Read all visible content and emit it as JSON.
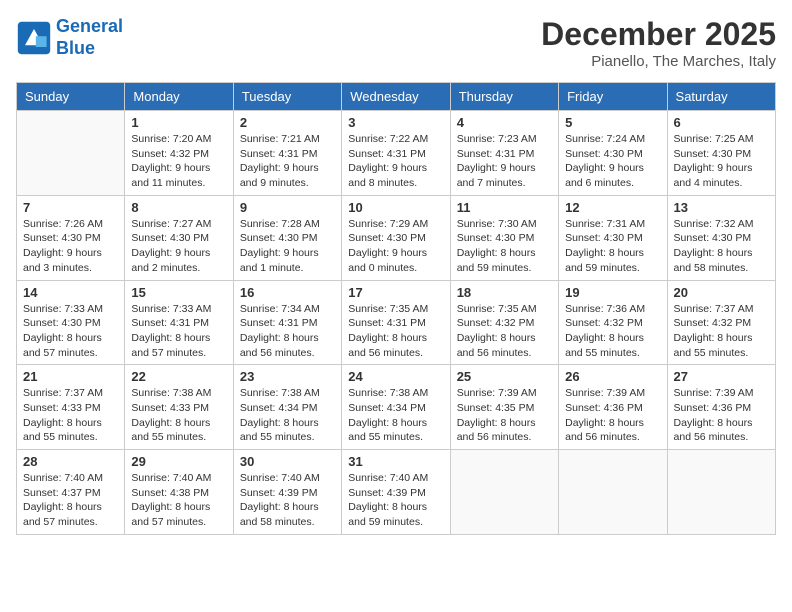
{
  "logo": {
    "line1": "General",
    "line2": "Blue"
  },
  "title": "December 2025",
  "location": "Pianello, The Marches, Italy",
  "headers": [
    "Sunday",
    "Monday",
    "Tuesday",
    "Wednesday",
    "Thursday",
    "Friday",
    "Saturday"
  ],
  "weeks": [
    [
      {
        "day": "",
        "info": ""
      },
      {
        "day": "1",
        "info": "Sunrise: 7:20 AM\nSunset: 4:32 PM\nDaylight: 9 hours\nand 11 minutes."
      },
      {
        "day": "2",
        "info": "Sunrise: 7:21 AM\nSunset: 4:31 PM\nDaylight: 9 hours\nand 9 minutes."
      },
      {
        "day": "3",
        "info": "Sunrise: 7:22 AM\nSunset: 4:31 PM\nDaylight: 9 hours\nand 8 minutes."
      },
      {
        "day": "4",
        "info": "Sunrise: 7:23 AM\nSunset: 4:31 PM\nDaylight: 9 hours\nand 7 minutes."
      },
      {
        "day": "5",
        "info": "Sunrise: 7:24 AM\nSunset: 4:30 PM\nDaylight: 9 hours\nand 6 minutes."
      },
      {
        "day": "6",
        "info": "Sunrise: 7:25 AM\nSunset: 4:30 PM\nDaylight: 9 hours\nand 4 minutes."
      }
    ],
    [
      {
        "day": "7",
        "info": "Sunrise: 7:26 AM\nSunset: 4:30 PM\nDaylight: 9 hours\nand 3 minutes."
      },
      {
        "day": "8",
        "info": "Sunrise: 7:27 AM\nSunset: 4:30 PM\nDaylight: 9 hours\nand 2 minutes."
      },
      {
        "day": "9",
        "info": "Sunrise: 7:28 AM\nSunset: 4:30 PM\nDaylight: 9 hours\nand 1 minute."
      },
      {
        "day": "10",
        "info": "Sunrise: 7:29 AM\nSunset: 4:30 PM\nDaylight: 9 hours\nand 0 minutes."
      },
      {
        "day": "11",
        "info": "Sunrise: 7:30 AM\nSunset: 4:30 PM\nDaylight: 8 hours\nand 59 minutes."
      },
      {
        "day": "12",
        "info": "Sunrise: 7:31 AM\nSunset: 4:30 PM\nDaylight: 8 hours\nand 59 minutes."
      },
      {
        "day": "13",
        "info": "Sunrise: 7:32 AM\nSunset: 4:30 PM\nDaylight: 8 hours\nand 58 minutes."
      }
    ],
    [
      {
        "day": "14",
        "info": "Sunrise: 7:33 AM\nSunset: 4:30 PM\nDaylight: 8 hours\nand 57 minutes."
      },
      {
        "day": "15",
        "info": "Sunrise: 7:33 AM\nSunset: 4:31 PM\nDaylight: 8 hours\nand 57 minutes."
      },
      {
        "day": "16",
        "info": "Sunrise: 7:34 AM\nSunset: 4:31 PM\nDaylight: 8 hours\nand 56 minutes."
      },
      {
        "day": "17",
        "info": "Sunrise: 7:35 AM\nSunset: 4:31 PM\nDaylight: 8 hours\nand 56 minutes."
      },
      {
        "day": "18",
        "info": "Sunrise: 7:35 AM\nSunset: 4:32 PM\nDaylight: 8 hours\nand 56 minutes."
      },
      {
        "day": "19",
        "info": "Sunrise: 7:36 AM\nSunset: 4:32 PM\nDaylight: 8 hours\nand 55 minutes."
      },
      {
        "day": "20",
        "info": "Sunrise: 7:37 AM\nSunset: 4:32 PM\nDaylight: 8 hours\nand 55 minutes."
      }
    ],
    [
      {
        "day": "21",
        "info": "Sunrise: 7:37 AM\nSunset: 4:33 PM\nDaylight: 8 hours\nand 55 minutes."
      },
      {
        "day": "22",
        "info": "Sunrise: 7:38 AM\nSunset: 4:33 PM\nDaylight: 8 hours\nand 55 minutes."
      },
      {
        "day": "23",
        "info": "Sunrise: 7:38 AM\nSunset: 4:34 PM\nDaylight: 8 hours\nand 55 minutes."
      },
      {
        "day": "24",
        "info": "Sunrise: 7:38 AM\nSunset: 4:34 PM\nDaylight: 8 hours\nand 55 minutes."
      },
      {
        "day": "25",
        "info": "Sunrise: 7:39 AM\nSunset: 4:35 PM\nDaylight: 8 hours\nand 56 minutes."
      },
      {
        "day": "26",
        "info": "Sunrise: 7:39 AM\nSunset: 4:36 PM\nDaylight: 8 hours\nand 56 minutes."
      },
      {
        "day": "27",
        "info": "Sunrise: 7:39 AM\nSunset: 4:36 PM\nDaylight: 8 hours\nand 56 minutes."
      }
    ],
    [
      {
        "day": "28",
        "info": "Sunrise: 7:40 AM\nSunset: 4:37 PM\nDaylight: 8 hours\nand 57 minutes."
      },
      {
        "day": "29",
        "info": "Sunrise: 7:40 AM\nSunset: 4:38 PM\nDaylight: 8 hours\nand 57 minutes."
      },
      {
        "day": "30",
        "info": "Sunrise: 7:40 AM\nSunset: 4:39 PM\nDaylight: 8 hours\nand 58 minutes."
      },
      {
        "day": "31",
        "info": "Sunrise: 7:40 AM\nSunset: 4:39 PM\nDaylight: 8 hours\nand 59 minutes."
      },
      {
        "day": "",
        "info": ""
      },
      {
        "day": "",
        "info": ""
      },
      {
        "day": "",
        "info": ""
      }
    ]
  ]
}
